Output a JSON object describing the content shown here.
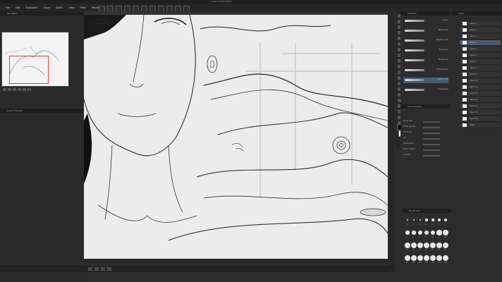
{
  "window": {
    "title": "CLIP STUDIO PAINT"
  },
  "menu": [
    "File",
    "Edit",
    "Animation",
    "Layer",
    "Select",
    "View",
    "Filter",
    "Window",
    "Help"
  ],
  "navigator": {
    "title": "Navigator"
  },
  "layer_property": {
    "title": "Layer Property"
  },
  "sub_tool_panel": {
    "title": "Sub Tool",
    "brushes": [
      {
        "name": "G-pen",
        "size": ""
      },
      {
        "name": "Real G-pen",
        "size": ""
      },
      {
        "name": "Mapping pen",
        "size": ""
      },
      {
        "name": "Turnip pen",
        "size": ""
      },
      {
        "name": "Rough pen",
        "size": ""
      },
      {
        "name": "Textured pen",
        "size": ""
      },
      {
        "name": "Marker pen",
        "size": ""
      },
      {
        "name": "Calligraphy",
        "size": ""
      }
    ]
  },
  "tool_property": {
    "title": "Tool Property",
    "rows": [
      {
        "label": "Brush Size",
        "value": ""
      },
      {
        "label": "Brush density",
        "value": ""
      },
      {
        "label": "Thickness",
        "value": ""
      },
      {
        "label": "Ink",
        "value": ""
      },
      {
        "label": "Stabilization",
        "value": ""
      },
      {
        "label": "Vector eraser",
        "value": ""
      },
      {
        "label": "Gradient",
        "value": ""
      }
    ]
  },
  "layer_panel": {
    "title": "Layer",
    "layers": [
      {
        "name": "Layer 1"
      },
      {
        "name": "Layer 2"
      },
      {
        "name": "Layer 3"
      },
      {
        "name": "Layer 4"
      },
      {
        "name": "Layer 5"
      },
      {
        "name": "Layer 6"
      },
      {
        "name": "Layer 7"
      },
      {
        "name": "Layer 8"
      },
      {
        "name": "Layer 9"
      },
      {
        "name": "Layer 10"
      },
      {
        "name": "Layer 11"
      },
      {
        "name": "Layer 12"
      },
      {
        "name": "Layer 13"
      },
      {
        "name": "Layer 14"
      },
      {
        "name": "Layer 15"
      },
      {
        "name": "Layer 16"
      },
      {
        "name": "Paper"
      }
    ],
    "selected_index": 3
  },
  "brush_size_panel": {
    "title": "Brush Size",
    "sizes": [
      "0.7",
      "1",
      "1.5",
      "2",
      "2.5",
      "3",
      "4",
      "5",
      "6",
      "7",
      "8",
      "10",
      "12",
      "15",
      "17",
      "20",
      "25",
      "30",
      "40",
      "50",
      "60",
      "70",
      "80",
      "100",
      "120",
      "150",
      "170",
      "200"
    ]
  },
  "colors": {
    "canvas": "#ececec",
    "selection": "#4a5a6c",
    "nav_frame": "#e04040"
  }
}
